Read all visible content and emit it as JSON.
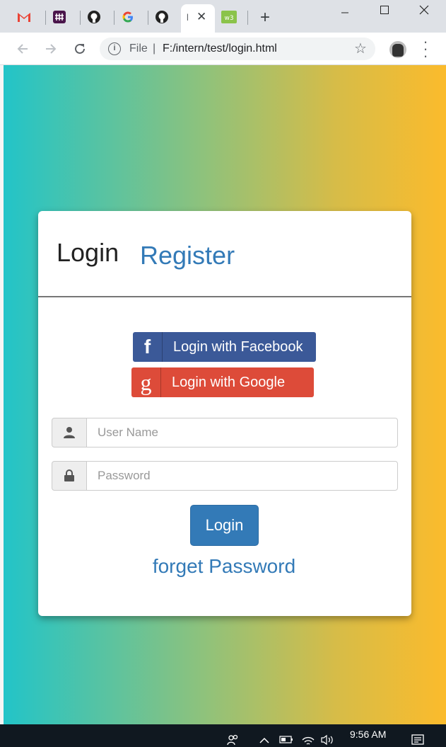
{
  "browser": {
    "tabs": [
      {
        "icon": "gmail-icon"
      },
      {
        "icon": "slack-icon"
      },
      {
        "icon": "github-icon"
      },
      {
        "icon": "google-icon"
      },
      {
        "icon": "github-icon"
      },
      {
        "title_fragment": "l",
        "icon": "close-icon",
        "active": true
      },
      {
        "icon": "w3schools-icon"
      }
    ],
    "new_tab": "+",
    "address": {
      "scheme_label": "File",
      "separator": "|",
      "url": "F:/intern/test/login.html"
    }
  },
  "card": {
    "tab_login": "Login",
    "tab_register": "Register",
    "facebook_label": "Login with Facebook",
    "facebook_glyph": "f",
    "google_label": "Login with Google",
    "google_glyph": "g",
    "username_placeholder": "User Name",
    "password_placeholder": "Password",
    "login_button": "Login",
    "forget_link": "forget Password"
  },
  "taskbar": {
    "time": "9:56 AM"
  },
  "colors": {
    "gradient_start": "#22c4c8",
    "gradient_end": "#fbbb2c",
    "primary": "#337ab7",
    "facebook": "#3b5998",
    "google": "#dd4b39"
  }
}
